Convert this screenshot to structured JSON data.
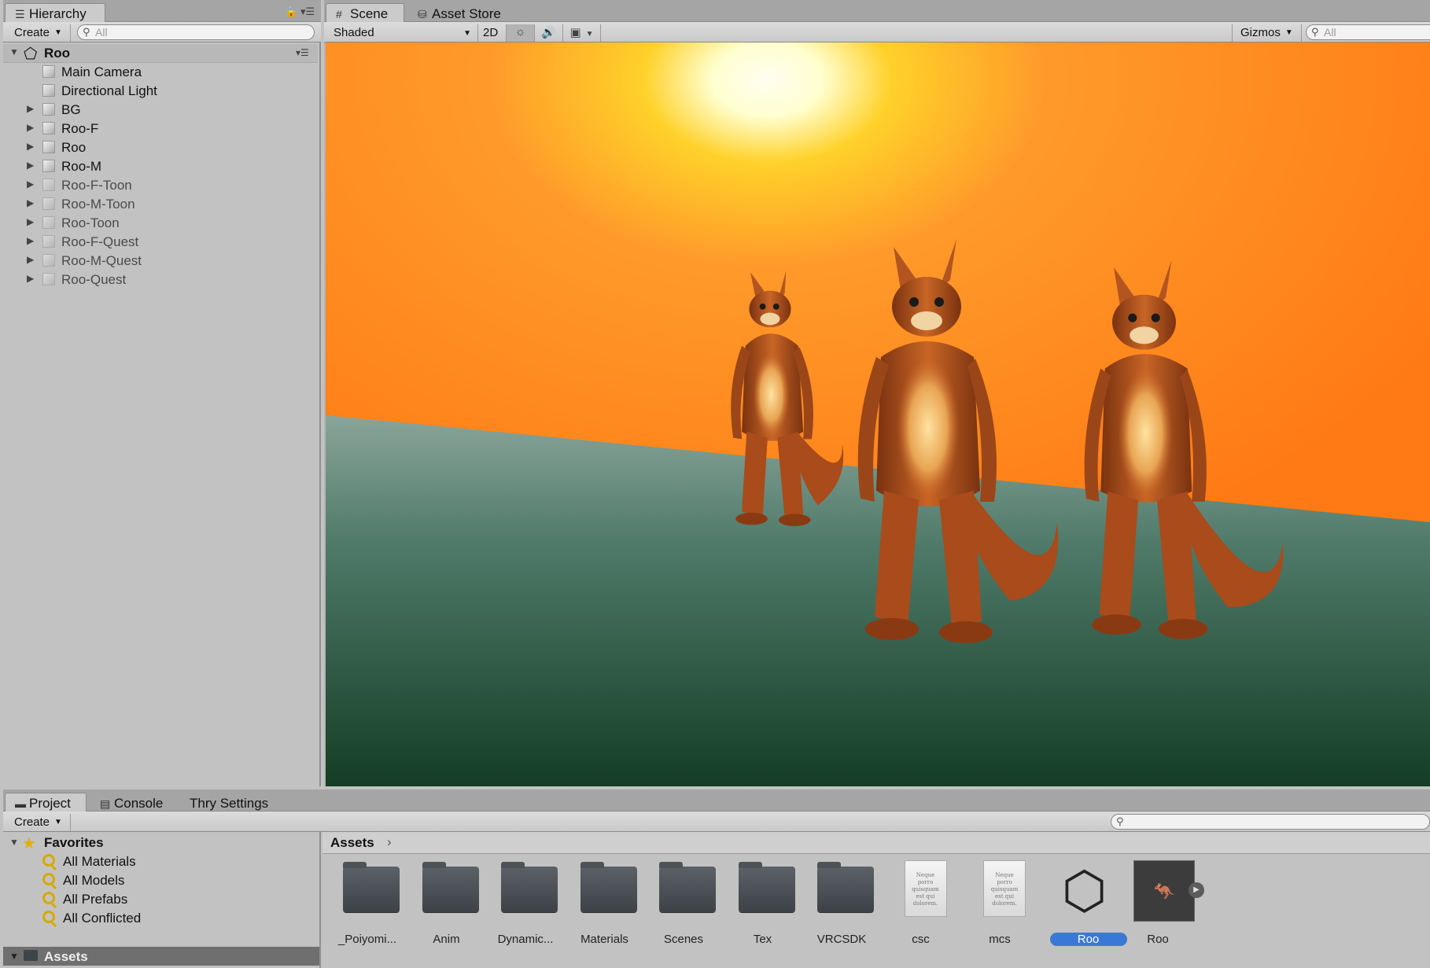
{
  "hierarchy": {
    "tab_label": "Hierarchy",
    "create_label": "Create",
    "search_placeholder": "All",
    "scene_name": "Roo",
    "items": [
      {
        "label": "Main Camera",
        "expandable": false,
        "dim": false
      },
      {
        "label": "Directional Light",
        "expandable": false,
        "dim": false
      },
      {
        "label": "BG",
        "expandable": true,
        "dim": false
      },
      {
        "label": "Roo-F",
        "expandable": true,
        "dim": false
      },
      {
        "label": "Roo",
        "expandable": true,
        "dim": false
      },
      {
        "label": "Roo-M",
        "expandable": true,
        "dim": false
      },
      {
        "label": "Roo-F-Toon",
        "expandable": true,
        "dim": true
      },
      {
        "label": "Roo-M-Toon",
        "expandable": true,
        "dim": true
      },
      {
        "label": "Roo-Toon",
        "expandable": true,
        "dim": true
      },
      {
        "label": "Roo-F-Quest",
        "expandable": true,
        "dim": true
      },
      {
        "label": "Roo-M-Quest",
        "expandable": true,
        "dim": true
      },
      {
        "label": "Roo-Quest",
        "expandable": true,
        "dim": true
      }
    ]
  },
  "scene": {
    "tabs": [
      "Scene",
      "Asset Store"
    ],
    "shading_mode": "Shaded",
    "mode_2d": "2D",
    "gizmos_label": "Gizmos",
    "search_placeholder": "All",
    "sky_color": "#ff7a1a",
    "ground_color": "#2c5a48"
  },
  "project": {
    "tabs": [
      "Project",
      "Console",
      "Thry Settings"
    ],
    "create_label": "Create",
    "favorites_label": "Favorites",
    "favorites": [
      "All Materials",
      "All Models",
      "All Prefabs",
      "All Conflicted"
    ],
    "assets_root_label": "Assets",
    "breadcrumb": "Assets",
    "assets": [
      {
        "name": "_Poiyomi...",
        "type": "folder"
      },
      {
        "name": "Anim",
        "type": "folder"
      },
      {
        "name": "Dynamic...",
        "type": "folder"
      },
      {
        "name": "Materials",
        "type": "folder"
      },
      {
        "name": "Scenes",
        "type": "folder"
      },
      {
        "name": "Tex",
        "type": "folder"
      },
      {
        "name": "VRCSDK",
        "type": "folder"
      },
      {
        "name": "csc",
        "type": "document"
      },
      {
        "name": "mcs",
        "type": "document"
      },
      {
        "name": "Roo",
        "type": "unity-scene",
        "selected": true
      },
      {
        "name": "Roo",
        "type": "prefab"
      }
    ],
    "doc_preview_text": "Neque porro quisquam est qui dolorem.",
    "selection_color": "#3a78d6"
  }
}
